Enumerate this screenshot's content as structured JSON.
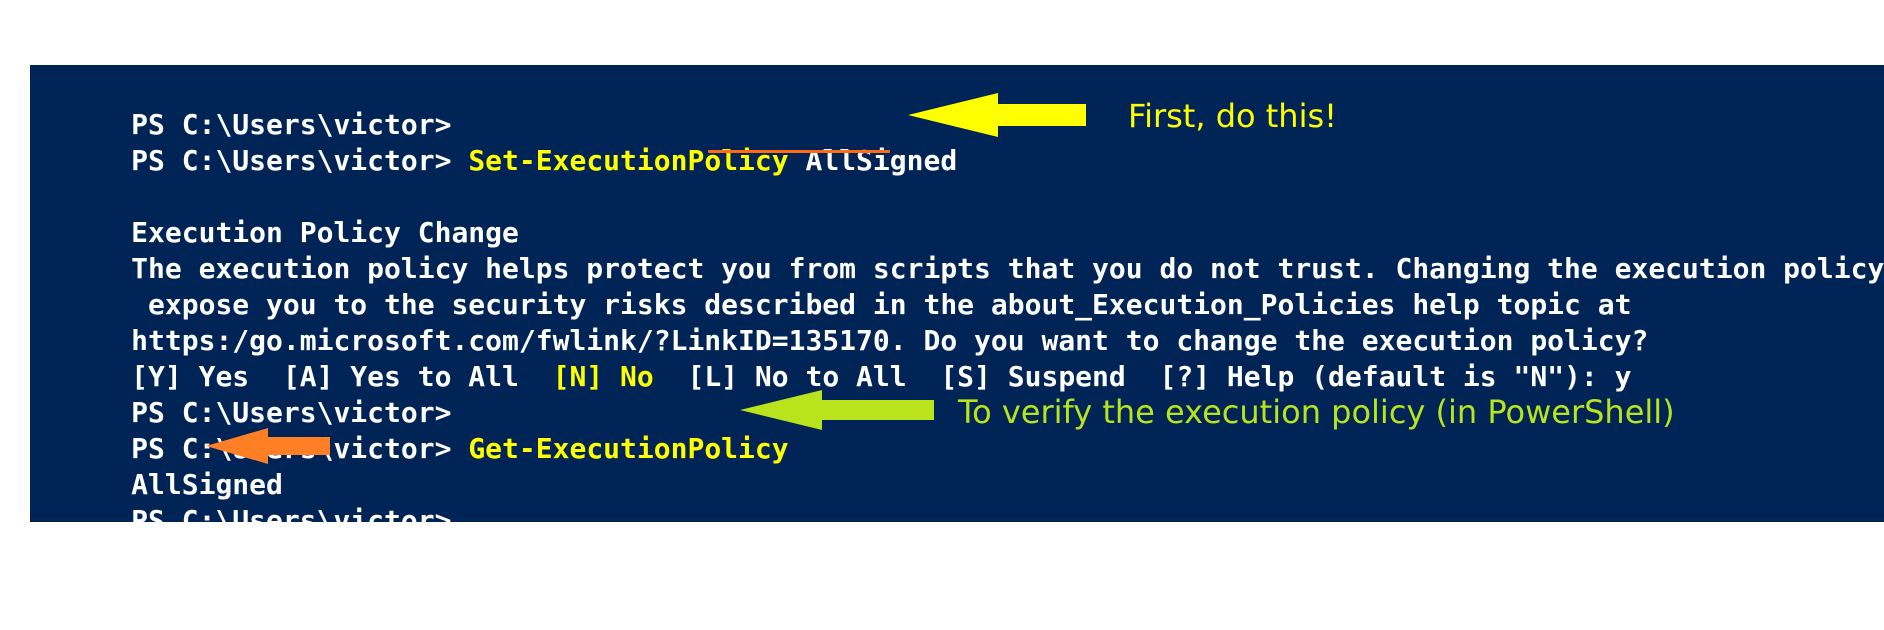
{
  "terminal": {
    "prompt": "PS C:\\Users\\victor>",
    "lines": {
      "l1": "PS C:\\Users\\victor>",
      "l2_prompt": "PS C:\\Users\\victor> ",
      "l2_cmd": "Set-ExecutionPolicy",
      "l2_arg": " AllSigned",
      "l3": "",
      "l4": "Execution Policy Change",
      "l5": "The execution policy helps protect you from scripts that you do not trust. Changing the execution policy migh",
      "l6": " expose you to the security risks described in the about_Execution_Policies help topic at",
      "l7": "https:/go.microsoft.com/fwlink/?LinkID=135170. Do you want to change the execution policy?",
      "l8_a": "[Y] Yes  [A] Yes to All  ",
      "l8_b": "[N] No",
      "l8_c": "  [L] No to All  [S] Suspend  [?] Help (default is \"N\"): y",
      "l9": "PS C:\\Users\\victor>",
      "l10_prompt": "PS C:\\Users\\victor> ",
      "l10_cmd": "Get-ExecutionPolicy",
      "l11": "AllSigned",
      "l12": "PS C:\\Users\\victor>"
    },
    "colors": {
      "background": "#012456",
      "text": "#ffffff",
      "command": "#ffff00"
    }
  },
  "annotations": {
    "first": "First, do this!",
    "verify": "To verify the execution policy (in PowerShell)",
    "colors": {
      "yellow_arrow": "#ffff00",
      "green_arrow": "#b8e31d",
      "orange_arrow": "#ff7f27",
      "underline": "#ff6a13"
    }
  }
}
